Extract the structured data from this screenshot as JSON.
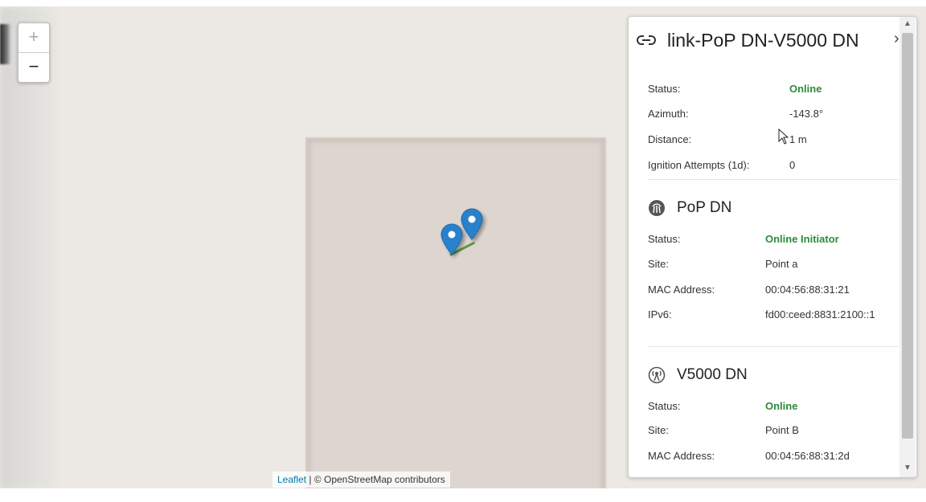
{
  "map": {
    "zoom_in": "+",
    "zoom_out": "−",
    "attribution_link": "Leaflet",
    "attribution_text": " | © OpenStreetMap contributors",
    "marker_color": "#2a81cb",
    "link_color": "#5b9a3d"
  },
  "panel": {
    "title": "link-PoP DN-V5000 DN",
    "title_icon": "link-icon",
    "close": "›",
    "link_info": [
      {
        "label": "Status:",
        "value": "Online",
        "status": true
      },
      {
        "label": "Azimuth:",
        "value": "-143.8°"
      },
      {
        "label": "Distance:",
        "value": "1 m"
      },
      {
        "label": "Ignition Attempts (1d):",
        "value": "0"
      }
    ],
    "node_a": {
      "name": "PoP DN",
      "icon": "pop-node-icon",
      "rows": [
        {
          "label": "Status:",
          "value": "Online Initiator",
          "status": true
        },
        {
          "label": "Site:",
          "value": "Point a"
        },
        {
          "label": "MAC Address:",
          "value": "00:04:56:88:31:21"
        },
        {
          "label": "IPv6:",
          "value": "fd00:ceed:8831:2100::1"
        }
      ]
    },
    "node_b": {
      "name": "V5000 DN",
      "icon": "radio-node-icon",
      "rows": [
        {
          "label": "Status:",
          "value": "Online",
          "status": true
        },
        {
          "label": "Site:",
          "value": "Point B"
        },
        {
          "label": "MAC Address:",
          "value": "00:04:56:88:31:2d"
        }
      ]
    },
    "status_color": "#2e8b3a"
  }
}
